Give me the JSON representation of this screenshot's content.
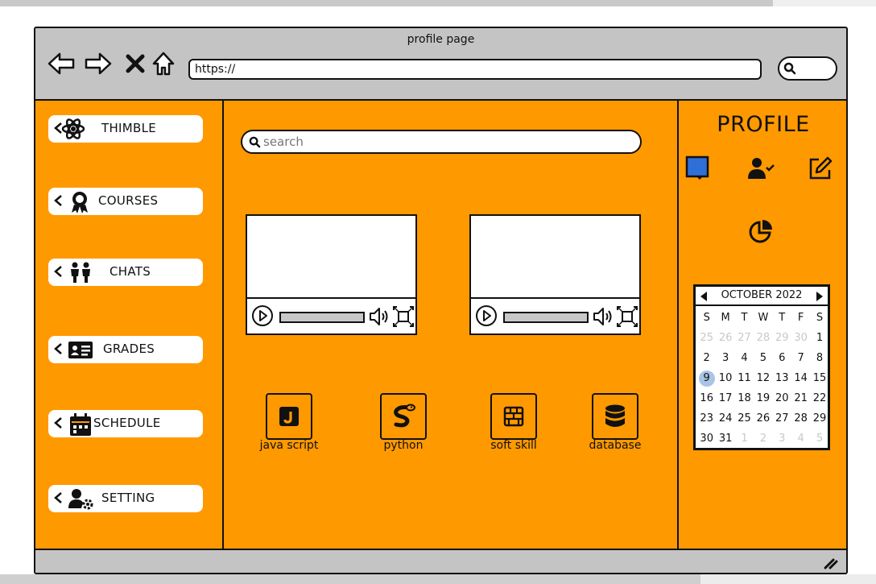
{
  "window": {
    "title": "profile page",
    "url": "https://"
  },
  "sidebar": {
    "items": [
      {
        "label": "THIMBLE",
        "icon": "atom-icon"
      },
      {
        "label": "COURSES",
        "icon": "award-icon"
      },
      {
        "label": "CHATS",
        "icon": "people-icon"
      },
      {
        "label": "GRADES",
        "icon": "id-card-icon"
      },
      {
        "label": "SCHEDULE",
        "icon": "calendar-icon"
      },
      {
        "label": "SETTING",
        "icon": "user-gear-icon"
      }
    ]
  },
  "main": {
    "search_placeholder": "search",
    "courses": [
      {
        "label": "java script",
        "icon": "javascript-icon"
      },
      {
        "label": "python",
        "icon": "python-icon"
      },
      {
        "label": "soft skill",
        "icon": "brick-wall-icon"
      },
      {
        "label": "database",
        "icon": "database-icon"
      }
    ]
  },
  "profile": {
    "title": "PROFILE",
    "colors": {
      "note_blue": "#2f6fd8",
      "accent": "#ff9900",
      "frame": "#c4c4c4"
    }
  },
  "calendar": {
    "month": "OCTOBER 2022",
    "weekdays": [
      "S",
      "M",
      "T",
      "W",
      "T",
      "F",
      "S"
    ],
    "weeks": [
      [
        "25",
        "26",
        "27",
        "28",
        "29",
        "30",
        "1"
      ],
      [
        "2",
        "3",
        "4",
        "5",
        "6",
        "7",
        "8"
      ],
      [
        "9",
        "10",
        "11",
        "12",
        "13",
        "14",
        "15"
      ],
      [
        "16",
        "17",
        "18",
        "19",
        "20",
        "21",
        "22"
      ],
      [
        "23",
        "24",
        "25",
        "26",
        "27",
        "28",
        "29"
      ],
      [
        "30",
        "31",
        "1",
        "2",
        "3",
        "4",
        "5"
      ]
    ],
    "selected_day": "9"
  }
}
